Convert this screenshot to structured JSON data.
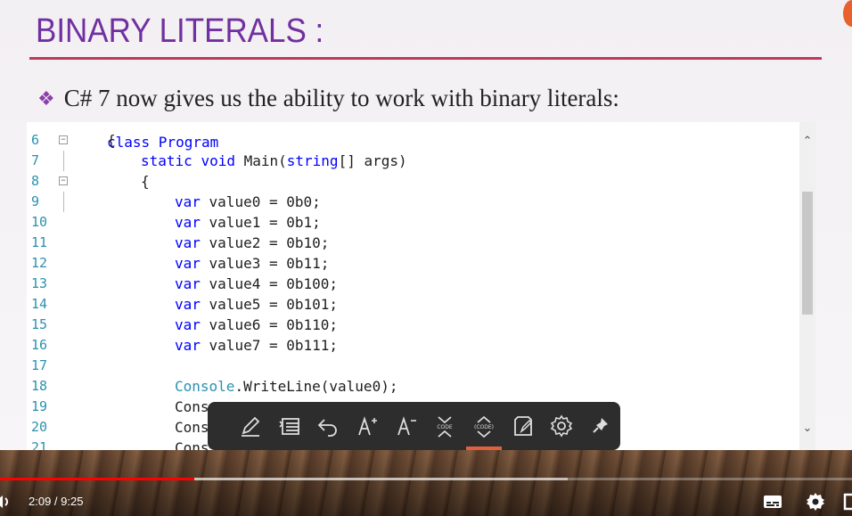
{
  "slide": {
    "title": "BINARY LITERALS :",
    "bullet": "C# 7 now gives us the ability to work with binary literals:"
  },
  "editor": {
    "partial_top": "class Program",
    "lines": [
      {
        "n": "6",
        "text": "{"
      },
      {
        "n": "7",
        "text": "static void Main(string[] args)"
      },
      {
        "n": "8",
        "text": "{"
      },
      {
        "n": "9",
        "text": "var value0 = 0b0;"
      },
      {
        "n": "10",
        "text": "var value1 = 0b1;"
      },
      {
        "n": "11",
        "text": "var value2 = 0b10;"
      },
      {
        "n": "12",
        "text": "var value3 = 0b11;"
      },
      {
        "n": "13",
        "text": "var value4 = 0b100;"
      },
      {
        "n": "14",
        "text": "var value5 = 0b101;"
      },
      {
        "n": "15",
        "text": "var value6 = 0b110;"
      },
      {
        "n": "16",
        "text": "var value7 = 0b111;"
      },
      {
        "n": "17",
        "text": ""
      },
      {
        "n": "18",
        "text": "Console.WriteLine(value0);"
      },
      {
        "n": "19",
        "text": "Cons"
      },
      {
        "n": "20",
        "text": "Cons"
      },
      {
        "n": "21",
        "text": "Cons"
      }
    ]
  },
  "toolbar": {
    "buttons": [
      "pen-icon",
      "list-icon",
      "undo-icon",
      "font-increase-icon",
      "font-decrease-icon",
      "collapse-code-icon",
      "expand-code-icon",
      "note-icon",
      "settings-icon",
      "pin-icon"
    ],
    "active": "expand-code-icon"
  },
  "player": {
    "time": "2:09 / 9:25",
    "progress": 0.2283,
    "buffered": 0.6658
  },
  "colors": {
    "title": "#7030a0",
    "rule": "#c0395a",
    "line_numbers": "#2b91af",
    "keyword": "#0000ff",
    "type": "#2b91af",
    "progress": "#ff0000"
  }
}
